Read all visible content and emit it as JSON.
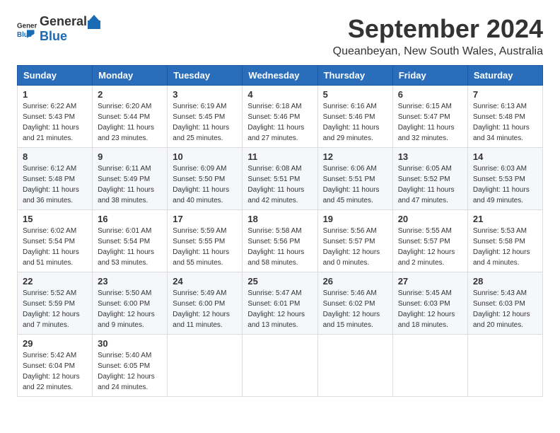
{
  "logo": {
    "general": "General",
    "blue": "Blue"
  },
  "title": "September 2024",
  "location": "Queanbeyan, New South Wales, Australia",
  "headers": [
    "Sunday",
    "Monday",
    "Tuesday",
    "Wednesday",
    "Thursday",
    "Friday",
    "Saturday"
  ],
  "weeks": [
    [
      {
        "day": "1",
        "sunrise": "6:22 AM",
        "sunset": "5:43 PM",
        "daylight": "11 hours and 21 minutes."
      },
      {
        "day": "2",
        "sunrise": "6:20 AM",
        "sunset": "5:44 PM",
        "daylight": "11 hours and 23 minutes."
      },
      {
        "day": "3",
        "sunrise": "6:19 AM",
        "sunset": "5:45 PM",
        "daylight": "11 hours and 25 minutes."
      },
      {
        "day": "4",
        "sunrise": "6:18 AM",
        "sunset": "5:46 PM",
        "daylight": "11 hours and 27 minutes."
      },
      {
        "day": "5",
        "sunrise": "6:16 AM",
        "sunset": "5:46 PM",
        "daylight": "11 hours and 29 minutes."
      },
      {
        "day": "6",
        "sunrise": "6:15 AM",
        "sunset": "5:47 PM",
        "daylight": "11 hours and 32 minutes."
      },
      {
        "day": "7",
        "sunrise": "6:13 AM",
        "sunset": "5:48 PM",
        "daylight": "11 hours and 34 minutes."
      }
    ],
    [
      {
        "day": "8",
        "sunrise": "6:12 AM",
        "sunset": "5:48 PM",
        "daylight": "11 hours and 36 minutes."
      },
      {
        "day": "9",
        "sunrise": "6:11 AM",
        "sunset": "5:49 PM",
        "daylight": "11 hours and 38 minutes."
      },
      {
        "day": "10",
        "sunrise": "6:09 AM",
        "sunset": "5:50 PM",
        "daylight": "11 hours and 40 minutes."
      },
      {
        "day": "11",
        "sunrise": "6:08 AM",
        "sunset": "5:51 PM",
        "daylight": "11 hours and 42 minutes."
      },
      {
        "day": "12",
        "sunrise": "6:06 AM",
        "sunset": "5:51 PM",
        "daylight": "11 hours and 45 minutes."
      },
      {
        "day": "13",
        "sunrise": "6:05 AM",
        "sunset": "5:52 PM",
        "daylight": "11 hours and 47 minutes."
      },
      {
        "day": "14",
        "sunrise": "6:03 AM",
        "sunset": "5:53 PM",
        "daylight": "11 hours and 49 minutes."
      }
    ],
    [
      {
        "day": "15",
        "sunrise": "6:02 AM",
        "sunset": "5:54 PM",
        "daylight": "11 hours and 51 minutes."
      },
      {
        "day": "16",
        "sunrise": "6:01 AM",
        "sunset": "5:54 PM",
        "daylight": "11 hours and 53 minutes."
      },
      {
        "day": "17",
        "sunrise": "5:59 AM",
        "sunset": "5:55 PM",
        "daylight": "11 hours and 55 minutes."
      },
      {
        "day": "18",
        "sunrise": "5:58 AM",
        "sunset": "5:56 PM",
        "daylight": "11 hours and 58 minutes."
      },
      {
        "day": "19",
        "sunrise": "5:56 AM",
        "sunset": "5:57 PM",
        "daylight": "12 hours and 0 minutes."
      },
      {
        "day": "20",
        "sunrise": "5:55 AM",
        "sunset": "5:57 PM",
        "daylight": "12 hours and 2 minutes."
      },
      {
        "day": "21",
        "sunrise": "5:53 AM",
        "sunset": "5:58 PM",
        "daylight": "12 hours and 4 minutes."
      }
    ],
    [
      {
        "day": "22",
        "sunrise": "5:52 AM",
        "sunset": "5:59 PM",
        "daylight": "12 hours and 7 minutes."
      },
      {
        "day": "23",
        "sunrise": "5:50 AM",
        "sunset": "6:00 PM",
        "daylight": "12 hours and 9 minutes."
      },
      {
        "day": "24",
        "sunrise": "5:49 AM",
        "sunset": "6:00 PM",
        "daylight": "12 hours and 11 minutes."
      },
      {
        "day": "25",
        "sunrise": "5:47 AM",
        "sunset": "6:01 PM",
        "daylight": "12 hours and 13 minutes."
      },
      {
        "day": "26",
        "sunrise": "5:46 AM",
        "sunset": "6:02 PM",
        "daylight": "12 hours and 15 minutes."
      },
      {
        "day": "27",
        "sunrise": "5:45 AM",
        "sunset": "6:03 PM",
        "daylight": "12 hours and 18 minutes."
      },
      {
        "day": "28",
        "sunrise": "5:43 AM",
        "sunset": "6:03 PM",
        "daylight": "12 hours and 20 minutes."
      }
    ],
    [
      {
        "day": "29",
        "sunrise": "5:42 AM",
        "sunset": "6:04 PM",
        "daylight": "12 hours and 22 minutes."
      },
      {
        "day": "30",
        "sunrise": "5:40 AM",
        "sunset": "6:05 PM",
        "daylight": "12 hours and 24 minutes."
      },
      null,
      null,
      null,
      null,
      null
    ]
  ]
}
